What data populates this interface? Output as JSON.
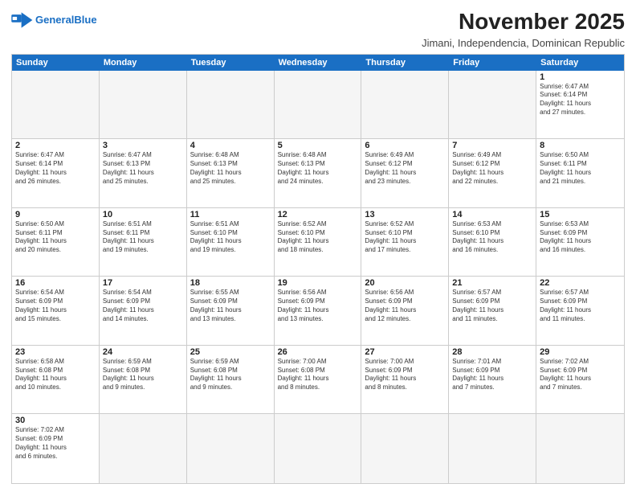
{
  "header": {
    "logo_line1": "General",
    "logo_line2": "Blue",
    "month_title": "November 2025",
    "subtitle": "Jimani, Independencia, Dominican Republic"
  },
  "day_headers": [
    "Sunday",
    "Monday",
    "Tuesday",
    "Wednesday",
    "Thursday",
    "Friday",
    "Saturday"
  ],
  "days": [
    {
      "num": "",
      "empty": true,
      "info": ""
    },
    {
      "num": "",
      "empty": true,
      "info": ""
    },
    {
      "num": "",
      "empty": true,
      "info": ""
    },
    {
      "num": "",
      "empty": true,
      "info": ""
    },
    {
      "num": "",
      "empty": true,
      "info": ""
    },
    {
      "num": "",
      "empty": true,
      "info": ""
    },
    {
      "num": "1",
      "empty": false,
      "info": "Sunrise: 6:47 AM\nSunset: 6:14 PM\nDaylight: 11 hours\nand 27 minutes."
    },
    {
      "num": "2",
      "empty": false,
      "info": "Sunrise: 6:47 AM\nSunset: 6:14 PM\nDaylight: 11 hours\nand 26 minutes."
    },
    {
      "num": "3",
      "empty": false,
      "info": "Sunrise: 6:47 AM\nSunset: 6:13 PM\nDaylight: 11 hours\nand 25 minutes."
    },
    {
      "num": "4",
      "empty": false,
      "info": "Sunrise: 6:48 AM\nSunset: 6:13 PM\nDaylight: 11 hours\nand 25 minutes."
    },
    {
      "num": "5",
      "empty": false,
      "info": "Sunrise: 6:48 AM\nSunset: 6:13 PM\nDaylight: 11 hours\nand 24 minutes."
    },
    {
      "num": "6",
      "empty": false,
      "info": "Sunrise: 6:49 AM\nSunset: 6:12 PM\nDaylight: 11 hours\nand 23 minutes."
    },
    {
      "num": "7",
      "empty": false,
      "info": "Sunrise: 6:49 AM\nSunset: 6:12 PM\nDaylight: 11 hours\nand 22 minutes."
    },
    {
      "num": "8",
      "empty": false,
      "info": "Sunrise: 6:50 AM\nSunset: 6:11 PM\nDaylight: 11 hours\nand 21 minutes."
    },
    {
      "num": "9",
      "empty": false,
      "info": "Sunrise: 6:50 AM\nSunset: 6:11 PM\nDaylight: 11 hours\nand 20 minutes."
    },
    {
      "num": "10",
      "empty": false,
      "info": "Sunrise: 6:51 AM\nSunset: 6:11 PM\nDaylight: 11 hours\nand 19 minutes."
    },
    {
      "num": "11",
      "empty": false,
      "info": "Sunrise: 6:51 AM\nSunset: 6:10 PM\nDaylight: 11 hours\nand 19 minutes."
    },
    {
      "num": "12",
      "empty": false,
      "info": "Sunrise: 6:52 AM\nSunset: 6:10 PM\nDaylight: 11 hours\nand 18 minutes."
    },
    {
      "num": "13",
      "empty": false,
      "info": "Sunrise: 6:52 AM\nSunset: 6:10 PM\nDaylight: 11 hours\nand 17 minutes."
    },
    {
      "num": "14",
      "empty": false,
      "info": "Sunrise: 6:53 AM\nSunset: 6:10 PM\nDaylight: 11 hours\nand 16 minutes."
    },
    {
      "num": "15",
      "empty": false,
      "info": "Sunrise: 6:53 AM\nSunset: 6:09 PM\nDaylight: 11 hours\nand 16 minutes."
    },
    {
      "num": "16",
      "empty": false,
      "info": "Sunrise: 6:54 AM\nSunset: 6:09 PM\nDaylight: 11 hours\nand 15 minutes."
    },
    {
      "num": "17",
      "empty": false,
      "info": "Sunrise: 6:54 AM\nSunset: 6:09 PM\nDaylight: 11 hours\nand 14 minutes."
    },
    {
      "num": "18",
      "empty": false,
      "info": "Sunrise: 6:55 AM\nSunset: 6:09 PM\nDaylight: 11 hours\nand 13 minutes."
    },
    {
      "num": "19",
      "empty": false,
      "info": "Sunrise: 6:56 AM\nSunset: 6:09 PM\nDaylight: 11 hours\nand 13 minutes."
    },
    {
      "num": "20",
      "empty": false,
      "info": "Sunrise: 6:56 AM\nSunset: 6:09 PM\nDaylight: 11 hours\nand 12 minutes."
    },
    {
      "num": "21",
      "empty": false,
      "info": "Sunrise: 6:57 AM\nSunset: 6:09 PM\nDaylight: 11 hours\nand 11 minutes."
    },
    {
      "num": "22",
      "empty": false,
      "info": "Sunrise: 6:57 AM\nSunset: 6:09 PM\nDaylight: 11 hours\nand 11 minutes."
    },
    {
      "num": "23",
      "empty": false,
      "info": "Sunrise: 6:58 AM\nSunset: 6:08 PM\nDaylight: 11 hours\nand 10 minutes."
    },
    {
      "num": "24",
      "empty": false,
      "info": "Sunrise: 6:59 AM\nSunset: 6:08 PM\nDaylight: 11 hours\nand 9 minutes."
    },
    {
      "num": "25",
      "empty": false,
      "info": "Sunrise: 6:59 AM\nSunset: 6:08 PM\nDaylight: 11 hours\nand 9 minutes."
    },
    {
      "num": "26",
      "empty": false,
      "info": "Sunrise: 7:00 AM\nSunset: 6:08 PM\nDaylight: 11 hours\nand 8 minutes."
    },
    {
      "num": "27",
      "empty": false,
      "info": "Sunrise: 7:00 AM\nSunset: 6:09 PM\nDaylight: 11 hours\nand 8 minutes."
    },
    {
      "num": "28",
      "empty": false,
      "info": "Sunrise: 7:01 AM\nSunset: 6:09 PM\nDaylight: 11 hours\nand 7 minutes."
    },
    {
      "num": "29",
      "empty": false,
      "info": "Sunrise: 7:02 AM\nSunset: 6:09 PM\nDaylight: 11 hours\nand 7 minutes."
    },
    {
      "num": "30",
      "empty": false,
      "info": "Sunrise: 7:02 AM\nSunset: 6:09 PM\nDaylight: 11 hours\nand 6 minutes."
    },
    {
      "num": "",
      "empty": true,
      "info": ""
    },
    {
      "num": "",
      "empty": true,
      "info": ""
    },
    {
      "num": "",
      "empty": true,
      "info": ""
    },
    {
      "num": "",
      "empty": true,
      "info": ""
    },
    {
      "num": "",
      "empty": true,
      "info": ""
    },
    {
      "num": "",
      "empty": true,
      "info": ""
    }
  ]
}
